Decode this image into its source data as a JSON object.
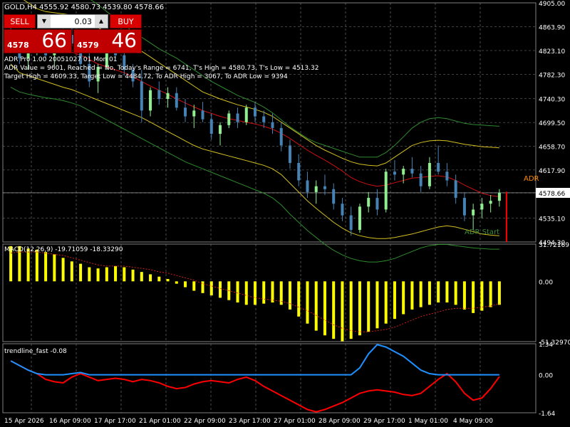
{
  "header": {
    "symbol_line": "GOLD,H4  4555.92 4580.73 4539.80 4578.66",
    "info_lines": [
      "ADR Pro 1.00 20051027 01 Mon 01",
      "ADR Value = 9601, Reached = No, Today's Range = 6741, T's High = 4580.73, T's Low = 4513.32",
      "Target High = 4609.33, Target Low = 4484.72, To ADR High = 3067, To ADR Low = 9394"
    ]
  },
  "trade_panel": {
    "sell_label": "SELL",
    "buy_label": "BUY",
    "lot_value": "0.03",
    "sell_price_small": "4578",
    "sell_price_big": "66",
    "buy_price_small": "4579",
    "buy_price_big": "46"
  },
  "colors": {
    "background": "#000000",
    "grid": "#808080",
    "bull_candle": "#90ee90",
    "bear_candle": "#4682b4",
    "ma_red": "#d01010",
    "band_yellow": "#d4c020",
    "band_green": "#2e8b2e",
    "macd_bar": "#ffff00",
    "signal_red": "#d02020",
    "trend_red": "#ff0000",
    "trend_blue": "#1e90ff"
  },
  "chart_data": [
    {
      "type": "candlestick",
      "title": "GOLD,H4",
      "ylim": [
        4494.3,
        4905.0
      ],
      "y_ticks": [
        "4905.00",
        "4863.90",
        "4823.10",
        "4782.30",
        "4740.30",
        "4699.50",
        "4658.70",
        "4617.90",
        "4578.66",
        "4535.10",
        "4494.30"
      ],
      "x_ticks": [
        "15 Apr 2026",
        "16 Apr 09:00",
        "17 Apr 17:00",
        "21 Apr 01:00",
        "22 Apr 09:00",
        "23 Apr 17:00",
        "27 Apr 01:00",
        "28 Apr 09:00",
        "29 Apr 17:00",
        "1 May 01:00",
        "4 May 09:00"
      ],
      "current_price": 4578.66,
      "annotations": [
        "ADR",
        "ADR Start"
      ],
      "ohlc": [
        [
          4850,
          4870,
          4820,
          4830
        ],
        [
          4830,
          4845,
          4800,
          4810
        ],
        [
          4810,
          4830,
          4790,
          4825
        ],
        [
          4825,
          4850,
          4815,
          4840
        ],
        [
          4840,
          4855,
          4810,
          4815
        ],
        [
          4815,
          4835,
          4795,
          4830
        ],
        [
          4830,
          4860,
          4825,
          4850
        ],
        [
          4850,
          4865,
          4830,
          4835
        ],
        [
          4835,
          4845,
          4790,
          4800
        ],
        [
          4800,
          4820,
          4760,
          4770
        ],
        [
          4770,
          4800,
          4750,
          4795
        ],
        [
          4795,
          4830,
          4790,
          4825
        ],
        [
          4825,
          4845,
          4810,
          4815
        ],
        [
          4815,
          4830,
          4780,
          4790
        ],
        [
          4790,
          4800,
          4760,
          4770
        ],
        [
          4770,
          4790,
          4700,
          4720
        ],
        [
          4720,
          4760,
          4710,
          4755
        ],
        [
          4755,
          4770,
          4730,
          4740
        ],
        [
          4740,
          4760,
          4725,
          4750
        ],
        [
          4750,
          4760,
          4720,
          4725
        ],
        [
          4725,
          4740,
          4700,
          4710
        ],
        [
          4710,
          4730,
          4690,
          4720
        ],
        [
          4720,
          4735,
          4700,
          4705
        ],
        [
          4705,
          4715,
          4670,
          4680
        ],
        [
          4680,
          4700,
          4660,
          4695
        ],
        [
          4695,
          4720,
          4690,
          4715
        ],
        [
          4715,
          4725,
          4690,
          4700
        ],
        [
          4700,
          4730,
          4695,
          4725
        ],
        [
          4725,
          4735,
          4700,
          4710
        ],
        [
          4710,
          4720,
          4690,
          4700
        ],
        [
          4700,
          4715,
          4680,
          4690
        ],
        [
          4690,
          4700,
          4650,
          4660
        ],
        [
          4660,
          4670,
          4620,
          4630
        ],
        [
          4630,
          4645,
          4590,
          4600
        ],
        [
          4600,
          4615,
          4570,
          4580
        ],
        [
          4580,
          4600,
          4560,
          4590
        ],
        [
          4590,
          4610,
          4575,
          4585
        ],
        [
          4585,
          4595,
          4550,
          4560
        ],
        [
          4560,
          4570,
          4530,
          4540
        ],
        [
          4540,
          4555,
          4505,
          4515
        ],
        [
          4515,
          4560,
          4510,
          4555
        ],
        [
          4555,
          4580,
          4545,
          4570
        ],
        [
          4570,
          4585,
          4540,
          4550
        ],
        [
          4550,
          4620,
          4545,
          4615
        ],
        [
          4615,
          4635,
          4600,
          4610
        ],
        [
          4610,
          4625,
          4595,
          4620
        ],
        [
          4620,
          4640,
          4605,
          4612
        ],
        [
          4612,
          4625,
          4580,
          4590
        ],
        [
          4590,
          4640,
          4585,
          4630
        ],
        [
          4630,
          4660,
          4610,
          4615
        ],
        [
          4615,
          4630,
          4590,
          4600
        ],
        [
          4600,
          4610,
          4560,
          4570
        ],
        [
          4570,
          4580,
          4530,
          4540
        ],
        [
          4540,
          4560,
          4515,
          4550
        ],
        [
          4550,
          4570,
          4535,
          4560
        ],
        [
          4560,
          4575,
          4545,
          4565
        ],
        [
          4565,
          4585,
          4555,
          4578.66
        ]
      ],
      "ma_red": [
        4860,
        4850,
        4842,
        4835,
        4830,
        4825,
        4822,
        4820,
        4815,
        4808,
        4800,
        4795,
        4790,
        4785,
        4778,
        4770,
        4762,
        4755,
        4748,
        4740,
        4733,
        4726,
        4720,
        4715,
        4710,
        4706,
        4703,
        4700,
        4697,
        4693,
        4688,
        4681,
        4672,
        4662,
        4652,
        4643,
        4635,
        4626,
        4616,
        4605,
        4598,
        4593,
        4590,
        4592,
        4596,
        4600,
        4604,
        4605,
        4607,
        4608,
        4606,
        4600,
        4592,
        4585,
        4578,
        4574,
        4572
      ],
      "band_yellow_upper": [
        4920,
        4915,
        4905,
        4895,
        4890,
        4888,
        4886,
        4884,
        4880,
        4872,
        4862,
        4855,
        4848,
        4840,
        4832,
        4822,
        4812,
        4802,
        4792,
        4782,
        4772,
        4762,
        4752,
        4746,
        4740,
        4735,
        4730,
        4726,
        4722,
        4717,
        4710,
        4700,
        4690,
        4680,
        4670,
        4660,
        4652,
        4645,
        4638,
        4632,
        4628,
        4626,
        4625,
        4630,
        4640,
        4650,
        4660,
        4665,
        4668,
        4669,
        4668,
        4665,
        4662,
        4660,
        4658,
        4657,
        4656
      ],
      "band_yellow_lower": [
        4800,
        4785,
        4780,
        4775,
        4770,
        4765,
        4760,
        4756,
        4750,
        4744,
        4738,
        4732,
        4726,
        4720,
        4714,
        4708,
        4700,
        4692,
        4684,
        4676,
        4668,
        4660,
        4654,
        4650,
        4646,
        4642,
        4638,
        4634,
        4630,
        4626,
        4620,
        4610,
        4595,
        4580,
        4565,
        4552,
        4540,
        4528,
        4518,
        4510,
        4505,
        4502,
        4500,
        4500,
        4502,
        4505,
        4508,
        4512,
        4516,
        4520,
        4522,
        4520,
        4516,
        4512,
        4508,
        4506,
        4505
      ],
      "band_green_upper": [
        4960,
        4955,
        4950,
        4945,
        4940,
        4935,
        4930,
        4926,
        4920,
        4912,
        4902,
        4890,
        4878,
        4866,
        4856,
        4846,
        4836,
        4826,
        4818,
        4810,
        4800,
        4790,
        4780,
        4770,
        4762,
        4754,
        4746,
        4740,
        4734,
        4726,
        4716,
        4704,
        4692,
        4682,
        4672,
        4665,
        4660,
        4655,
        4650,
        4645,
        4640,
        4640,
        4640,
        4648,
        4660,
        4675,
        4690,
        4700,
        4706,
        4708,
        4706,
        4702,
        4698,
        4696,
        4695,
        4694,
        4693
      ],
      "band_green_lower": [
        4760,
        4752,
        4748,
        4745,
        4742,
        4740,
        4737,
        4733,
        4728,
        4720,
        4712,
        4704,
        4696,
        4688,
        4680,
        4672,
        4664,
        4656,
        4648,
        4640,
        4632,
        4626,
        4620,
        4614,
        4608,
        4602,
        4596,
        4590,
        4584,
        4578,
        4570,
        4558,
        4542,
        4528,
        4514,
        4502,
        4490,
        4480,
        4472,
        4466,
        4462,
        4460,
        4460,
        4462,
        4466,
        4472,
        4478,
        4484,
        4488,
        4490,
        4490,
        4488,
        4486,
        4484,
        4483,
        4482,
        4482
      ]
    },
    {
      "type": "bar",
      "title": "MACD(12,26,9) -19.71059 -18.33290",
      "ylim": [
        -51.3297,
        31.72169
      ],
      "y_ticks": [
        "31.72169",
        "0.00",
        "-51.32970"
      ],
      "values": [
        30,
        30,
        28,
        27,
        25,
        23,
        20,
        17,
        15,
        12,
        11,
        12,
        13,
        12,
        10,
        8,
        6,
        4,
        2,
        -2,
        -5,
        -8,
        -10,
        -12,
        -14,
        -16,
        -18,
        -20,
        -20,
        -19,
        -18,
        -20,
        -24,
        -30,
        -36,
        -42,
        -46,
        -49,
        -51,
        -49,
        -46,
        -43,
        -40,
        -36,
        -32,
        -28,
        -24,
        -22,
        -20,
        -18,
        -18,
        -20,
        -24,
        -27,
        -25,
        -22,
        -20
      ],
      "signal": [
        24,
        25,
        25,
        25,
        24,
        23,
        22,
        20,
        18,
        16,
        14,
        13,
        13,
        13,
        12,
        11,
        10,
        8,
        7,
        5,
        3,
        1,
        -2,
        -4,
        -6,
        -8,
        -10,
        -12,
        -14,
        -15,
        -16,
        -17,
        -19,
        -22,
        -25,
        -29,
        -33,
        -37,
        -40,
        -42,
        -43,
        -43,
        -42,
        -41,
        -39,
        -36,
        -33,
        -30,
        -28,
        -26,
        -24,
        -23,
        -23,
        -23,
        -22,
        -21,
        -19
      ]
    },
    {
      "type": "line",
      "title": "trendline_fast -0.08",
      "ylim": [
        -1.64,
        1.34
      ],
      "y_ticks": [
        "1.34",
        "0.00",
        "-1.64"
      ],
      "series": [
        {
          "values": [
            0.6,
            0.4,
            0.2,
            0.05,
            -0.2,
            -0.3,
            -0.35,
            -0.1,
            0.05,
            -0.1,
            -0.25,
            -0.2,
            -0.15,
            -0.2,
            -0.3,
            -0.2,
            -0.25,
            -0.35,
            -0.5,
            -0.6,
            -0.55,
            -0.4,
            -0.3,
            -0.25,
            -0.3,
            -0.35,
            -0.2,
            -0.1,
            -0.25,
            -0.5,
            -0.7,
            -0.9,
            -1.1,
            -1.3,
            -1.5,
            -1.6,
            -1.5,
            -1.35,
            -1.2,
            -1.0,
            -0.8,
            -0.7,
            -0.65,
            -0.7,
            -0.75,
            -0.85,
            -0.9,
            -0.8,
            -0.5,
            -0.2,
            0.05,
            -0.3,
            -0.8,
            -1.1,
            -1.0,
            -0.6,
            -0.08
          ]
        },
        {
          "values": [
            0.6,
            0.4,
            0.2,
            0.05,
            0,
            0,
            0,
            0.05,
            0.1,
            0,
            0,
            0,
            0,
            0,
            0,
            0,
            0,
            0,
            0,
            0,
            0,
            0,
            0,
            0,
            0,
            0,
            0,
            0,
            0,
            0,
            0,
            0,
            0,
            0,
            0,
            0,
            0,
            0,
            0,
            0,
            0.3,
            0.9,
            1.3,
            1.2,
            1.0,
            0.8,
            0.5,
            0.2,
            0.05,
            0,
            0,
            0,
            0,
            0,
            0,
            0,
            0
          ]
        }
      ]
    }
  ]
}
